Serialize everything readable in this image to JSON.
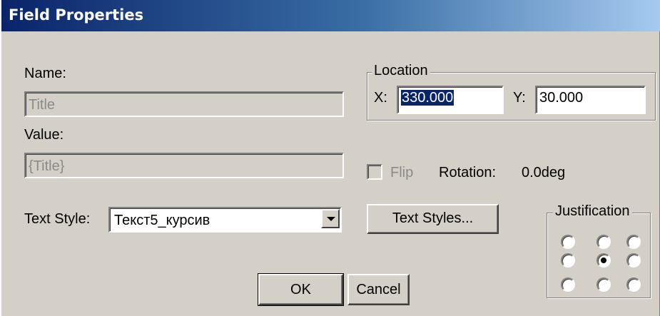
{
  "window": {
    "title": "Field Properties"
  },
  "name": {
    "label": "Name:",
    "value": "Title"
  },
  "value": {
    "label": "Value:",
    "value": "{Title}"
  },
  "location": {
    "legend": "Location",
    "x_label": "X:",
    "x_value": "330.000",
    "y_label": "Y:",
    "y_value": "30.000"
  },
  "flip": {
    "label": "Flip",
    "checked": false
  },
  "rotation": {
    "label": "Rotation:",
    "value": "0.0deg"
  },
  "text_style": {
    "label": "Text Style:",
    "selected": "Текст5_курсив"
  },
  "buttons": {
    "text_styles": "Text Styles...",
    "ok": "OK",
    "cancel": "Cancel"
  },
  "justification": {
    "legend": "Justification",
    "selected": "middle-center",
    "options": [
      "top-left",
      "top-center",
      "top-right",
      "middle-left",
      "middle-center",
      "middle-right",
      "bottom-left",
      "bottom-center",
      "bottom-right"
    ]
  },
  "icons": {
    "dropdown": "chevron-down-icon"
  }
}
